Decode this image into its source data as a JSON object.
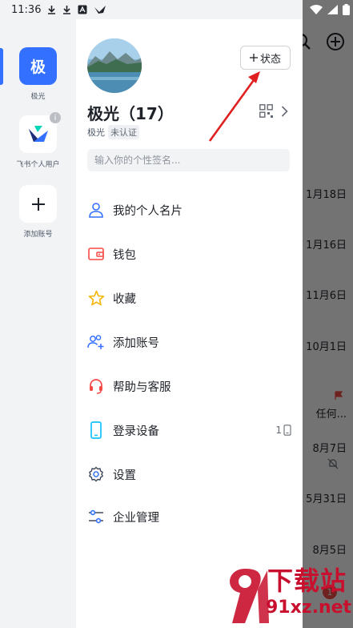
{
  "status_bar": {
    "time": "11:36"
  },
  "background": {
    "dates": [
      "1月18日",
      "1月16日",
      "11月6日",
      "10月1日",
      "任何...",
      "8月7日",
      "5月31日",
      "8月5日"
    ],
    "unread_count": "1"
  },
  "accounts": [
    {
      "initial": "极",
      "label": "极光"
    },
    {
      "label": "飞书个人用户"
    },
    {
      "label": "添加账号"
    }
  ],
  "profile": {
    "name": "极光（17）",
    "org": "极光",
    "verify_badge": "未认证",
    "status_button": "状态",
    "signature_placeholder": "输入你的个性签名..."
  },
  "menu": [
    {
      "label": "我的个人名片",
      "icon": "person-icon"
    },
    {
      "label": "钱包",
      "icon": "wallet-icon"
    },
    {
      "label": "收藏",
      "icon": "star-icon"
    },
    {
      "label": "添加账号",
      "icon": "add-user-icon"
    },
    {
      "label": "帮助与客服",
      "icon": "headset-icon"
    },
    {
      "label": "登录设备",
      "icon": "phone-icon",
      "count": "1"
    },
    {
      "label": "设置",
      "icon": "gear-icon"
    },
    {
      "label": "企业管理",
      "icon": "sliders-icon"
    }
  ],
  "watermark": {
    "line1": "下载站",
    "line2": "91xz.net"
  },
  "colors": {
    "accent": "#3370ff",
    "wallet": "#f54a45",
    "star": "#f5b400",
    "device": "#14c0ff",
    "annotation": "#e02020"
  }
}
